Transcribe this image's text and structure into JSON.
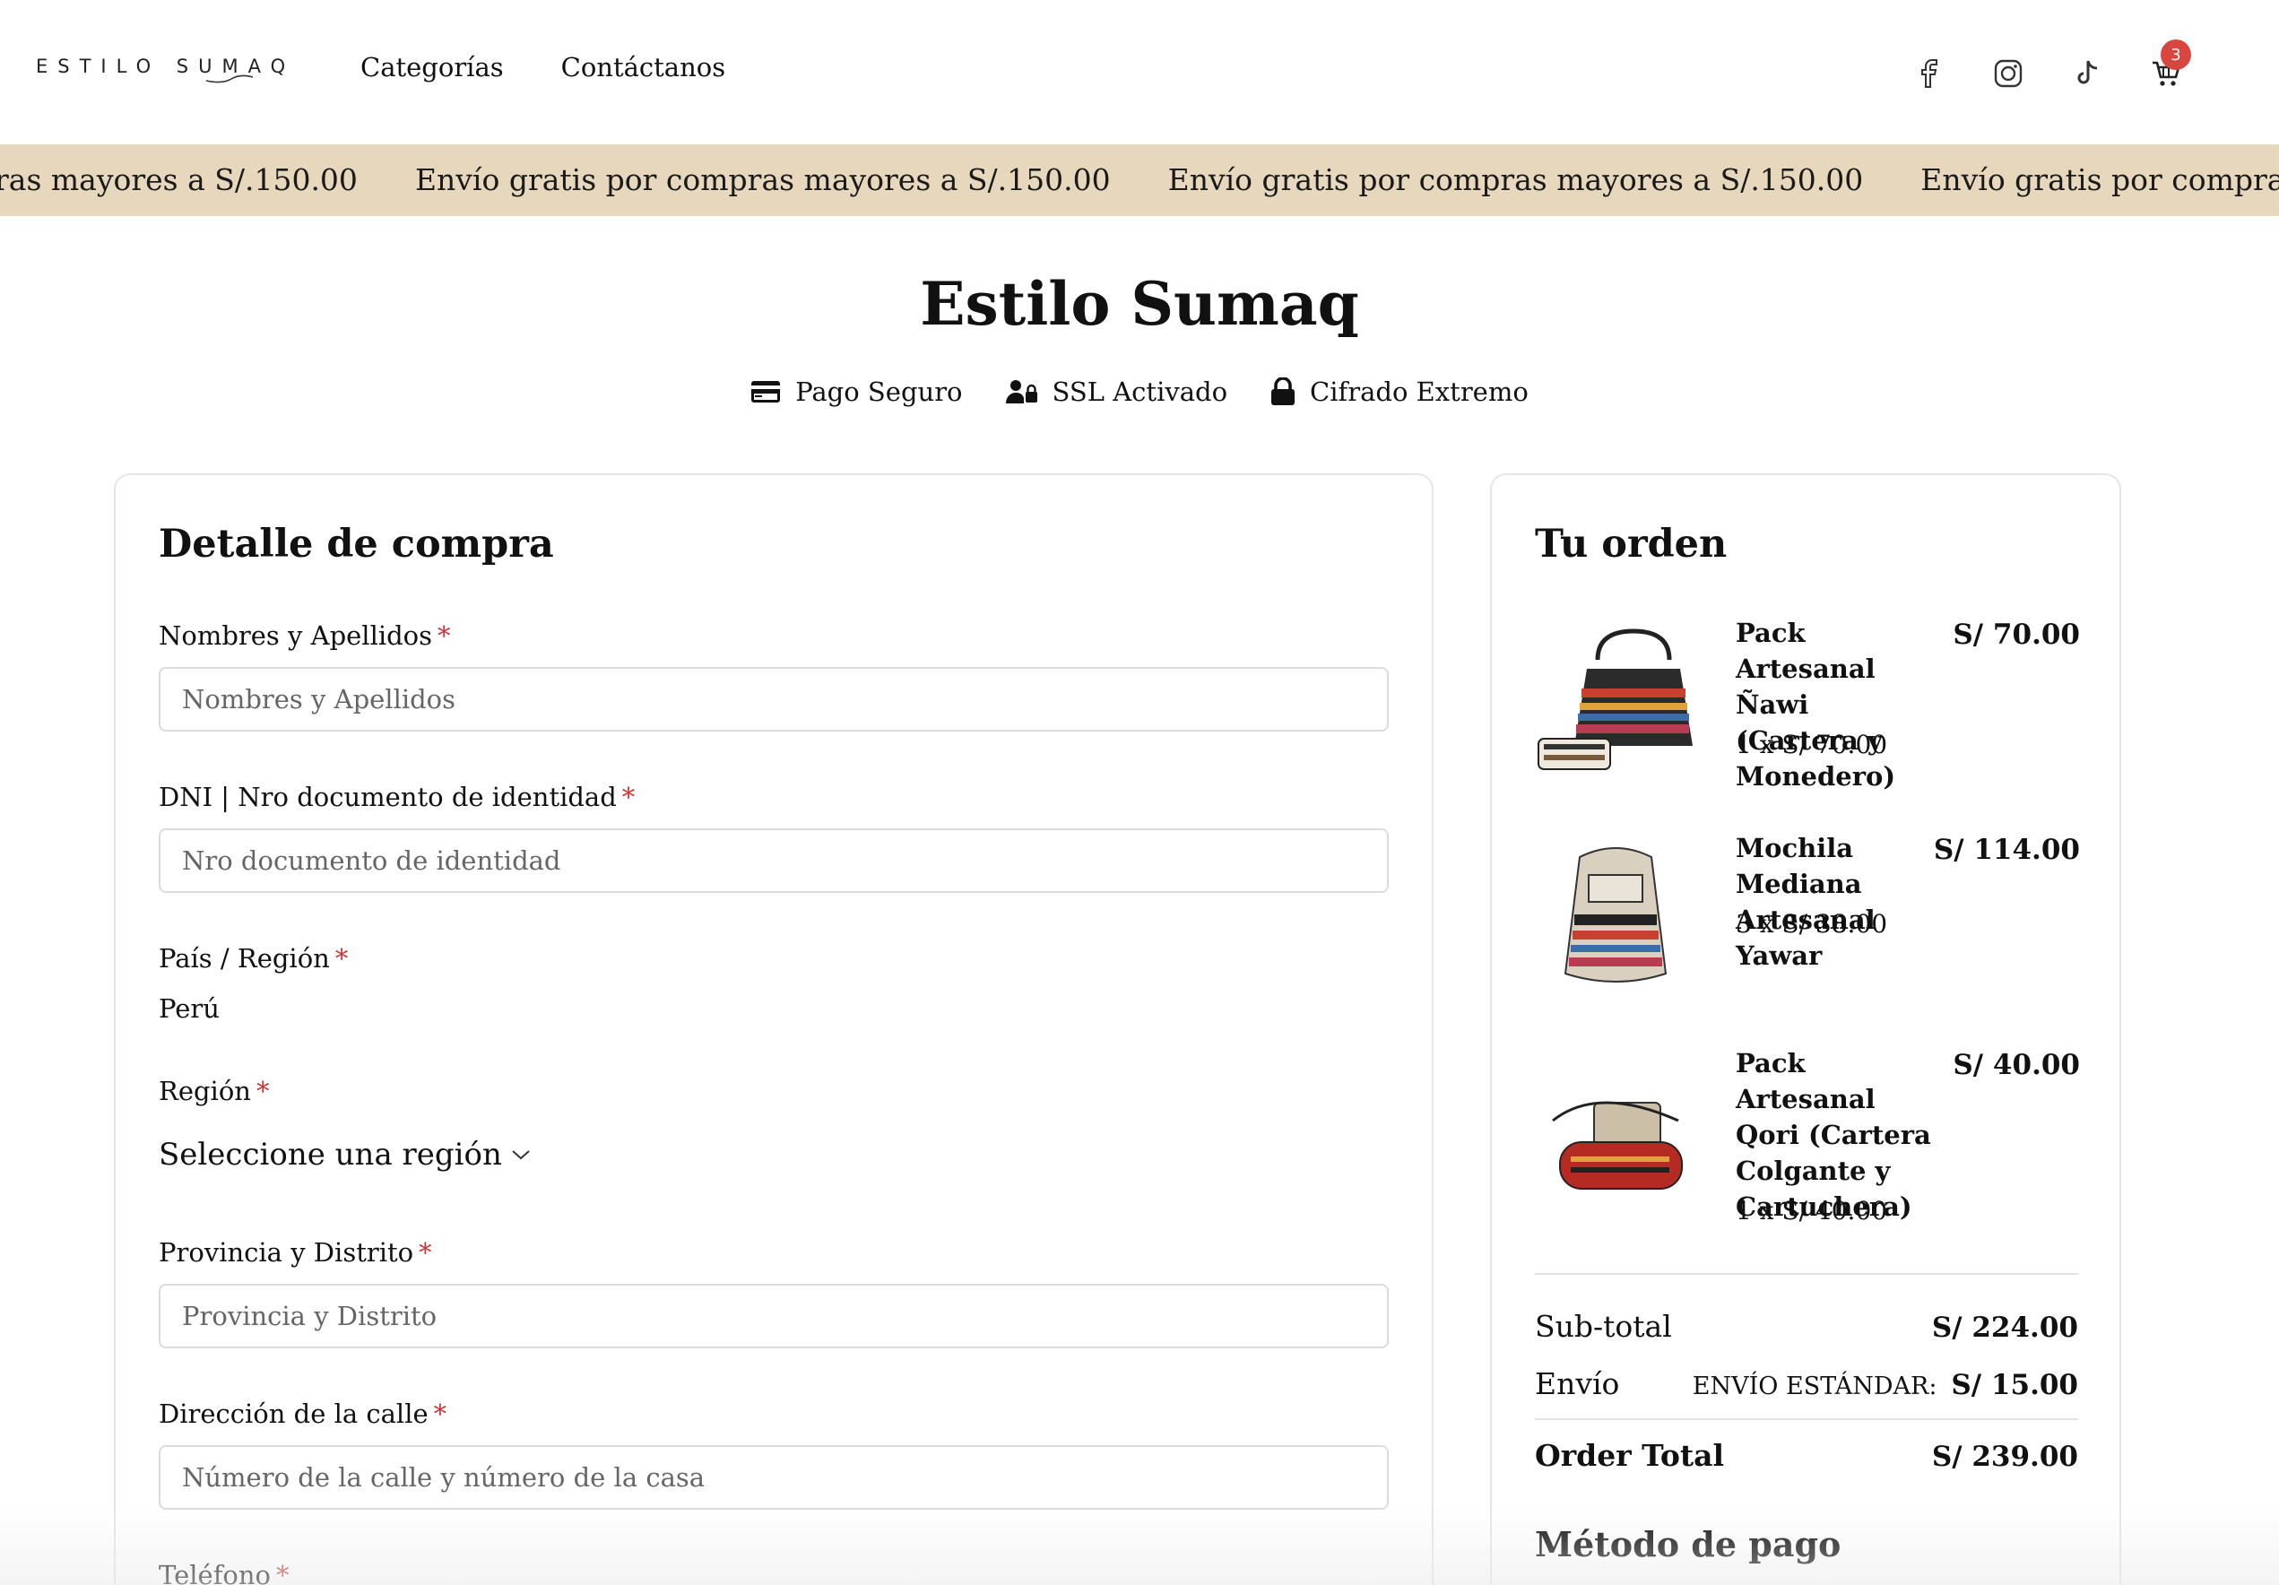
{
  "header": {
    "logo": "ESTILO SUMAQ",
    "nav": [
      "Categorías",
      "Contáctanos"
    ],
    "social_icons": [
      "facebook-icon",
      "instagram-icon",
      "tiktok-icon"
    ],
    "cart_count": "3"
  },
  "announcement": {
    "text": "Envío gratis por compras mayores a S/.150.00",
    "visible_start": "ras mayores a S/.150.00",
    "visible_end": "E"
  },
  "page": {
    "title": "Estilo Sumaq",
    "badges": [
      {
        "icon": "credit-card-icon",
        "label": "Pago Seguro"
      },
      {
        "icon": "user-lock-icon",
        "label": "SSL Activado"
      },
      {
        "icon": "lock-icon",
        "label": "Cifrado Extremo"
      }
    ]
  },
  "checkout": {
    "heading": "Detalle de compra",
    "fields": {
      "name": {
        "label": "Nombres y Apellidos",
        "placeholder": "Nombres y Apellidos"
      },
      "dni": {
        "label": "DNI | Nro documento de identidad",
        "placeholder": "Nro documento de identidad"
      },
      "country": {
        "label": "País / Región",
        "value": "Perú"
      },
      "region": {
        "label": "Región",
        "value": "Seleccione una región"
      },
      "province": {
        "label": "Provincia y Distrito",
        "placeholder": "Provincia y Distrito"
      },
      "street": {
        "label": "Dirección de la calle",
        "placeholder": "Número de la calle y número de la casa"
      },
      "phone": {
        "label": "Teléfono"
      }
    },
    "required_mark": "*"
  },
  "order": {
    "heading": "Tu orden",
    "items": [
      {
        "name": "Pack Artesanal Ñawi (Cartera y Monedero)",
        "price": "S/ 70.00",
        "qty": "1 x S/ 70.00"
      },
      {
        "name": "Mochila Mediana Artesanal Yawar",
        "price": "S/ 114.00",
        "qty": "3 x S/ 38.00"
      },
      {
        "name": "Pack Artesanal Qori (Cartera Colgante y Cartuchera)",
        "price": "S/ 40.00",
        "qty": "1 x S/ 40.00"
      }
    ],
    "subtotal_label": "Sub-total",
    "subtotal": "S/ 224.00",
    "shipping_label": "Envío",
    "shipping_method": "ENVÍO ESTÁNDAR:",
    "shipping": "S/ 15.00",
    "total_label": "Order Total",
    "total": "S/ 239.00",
    "payment_heading": "Método de pago"
  },
  "colors": {
    "announcement_bg": "#e7d8bd",
    "required": "#cc3333",
    "badge": "#d9463f"
  }
}
